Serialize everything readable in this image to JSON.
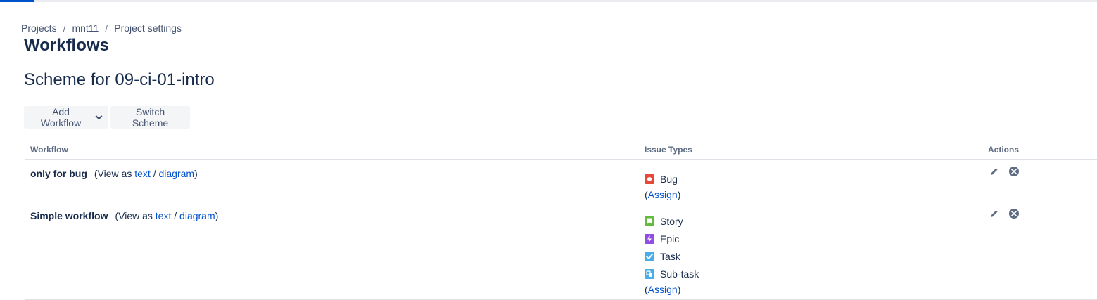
{
  "breadcrumb": {
    "items": [
      "Projects",
      "mnt11",
      "Project settings"
    ],
    "separator": "/"
  },
  "page_title": "Workflows",
  "scheme_title": "Scheme for 09-ci-01-intro",
  "toolbar": {
    "add_workflow_label": "Add Workflow",
    "switch_scheme_label": "Switch Scheme"
  },
  "table": {
    "headers": {
      "workflow": "Workflow",
      "issue_types": "Issue Types",
      "actions": "Actions"
    },
    "rows": [
      {
        "name": "only for bug",
        "view_as_prefix": "(View as",
        "text_link": "text",
        "slash": "/",
        "diagram_link": "diagram",
        "view_as_suffix": ")",
        "issue_types": [
          {
            "label": "Bug",
            "icon": "bug-icon",
            "color": "#e5493a"
          }
        ],
        "assign_open": "(",
        "assign_label": "Assign",
        "assign_close": ")",
        "actions": [
          "edit-icon",
          "delete-icon"
        ]
      },
      {
        "name": "Simple workflow",
        "view_as_prefix": "(View as",
        "text_link": "text",
        "slash": "/",
        "diagram_link": "diagram",
        "view_as_suffix": ")",
        "issue_types": [
          {
            "label": "Story",
            "icon": "story-icon",
            "color": "#63ba3c"
          },
          {
            "label": "Epic",
            "icon": "epic-icon",
            "color": "#904ee2"
          },
          {
            "label": "Task",
            "icon": "task-icon",
            "color": "#4bade8"
          },
          {
            "label": "Sub-task",
            "icon": "subtask-icon",
            "color": "#4bade8"
          }
        ],
        "assign_open": "(",
        "assign_label": "Assign",
        "assign_close": ")",
        "actions": [
          "edit-icon",
          "delete-icon"
        ]
      }
    ]
  },
  "colors": {
    "link": "#0052cc",
    "text": "#172b4d",
    "muted": "#42526e",
    "accent": "#0052cc"
  }
}
